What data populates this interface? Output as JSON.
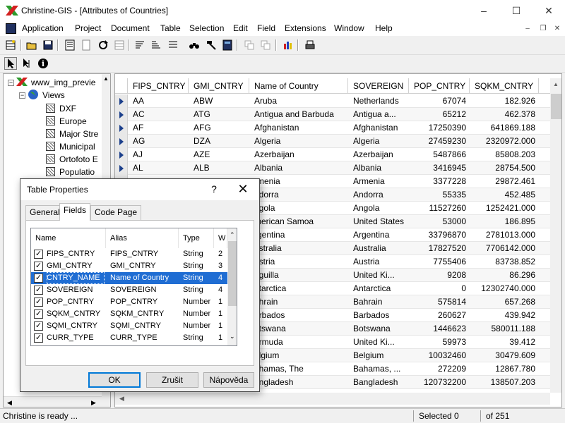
{
  "window": {
    "title": "Christine-GIS - [Attributes of Countries]"
  },
  "menu": [
    "Application",
    "Project",
    "Document",
    "Table",
    "Selection",
    "Edit",
    "Field",
    "Extensions",
    "Window",
    "Help"
  ],
  "tree": {
    "root": "www_img_previe",
    "views": "Views",
    "items": [
      "DXF",
      "Europe",
      "Major Stre",
      "Municipal",
      "Ortofoto E",
      "Populatio"
    ]
  },
  "table": {
    "columns": [
      "FIPS_CNTRY",
      "GMI_CNTRY",
      "Name of Country",
      "SOVEREIGN",
      "POP_CNTRY",
      "SQKM_CNTRY"
    ],
    "rows": [
      [
        "AA",
        "ABW",
        "Aruba",
        "Netherlands",
        "67074",
        "182.926"
      ],
      [
        "AC",
        "ATG",
        "Antigua and Barbuda",
        "Antigua a...",
        "65212",
        "462.378"
      ],
      [
        "AF",
        "AFG",
        "Afghanistan",
        "Afghanistan",
        "17250390",
        "641869.188"
      ],
      [
        "AG",
        "DZA",
        "Algeria",
        "Algeria",
        "27459230",
        "2320972.000"
      ],
      [
        "AJ",
        "AZE",
        "Azerbaijan",
        "Azerbaijan",
        "5487866",
        "85808.203"
      ],
      [
        "AL",
        "ALB",
        "Albania",
        "Albania",
        "3416945",
        "28754.500"
      ],
      [
        "",
        "",
        "rmenia",
        "Armenia",
        "3377228",
        "29872.461"
      ],
      [
        "",
        "",
        "ndorra",
        "Andorra",
        "55335",
        "452.485"
      ],
      [
        "",
        "",
        "ngola",
        "Angola",
        "11527260",
        "1252421.000"
      ],
      [
        "",
        "",
        "merican Samoa",
        "United States",
        "53000",
        "186.895"
      ],
      [
        "",
        "",
        "rgentina",
        "Argentina",
        "33796870",
        "2781013.000"
      ],
      [
        "",
        "",
        "ustralia",
        "Australia",
        "17827520",
        "7706142.000"
      ],
      [
        "",
        "",
        "ustria",
        "Austria",
        "7755406",
        "83738.852"
      ],
      [
        "",
        "",
        "nguilla",
        "United Ki...",
        "9208",
        "86.296"
      ],
      [
        "",
        "",
        "ntarctica",
        "Antarctica",
        "0",
        "12302740.000"
      ],
      [
        "",
        "",
        "ahrain",
        "Bahrain",
        "575814",
        "657.268"
      ],
      [
        "",
        "",
        "arbados",
        "Barbados",
        "260627",
        "439.942"
      ],
      [
        "",
        "",
        "otswana",
        "Botswana",
        "1446623",
        "580011.188"
      ],
      [
        "",
        "",
        "ermuda",
        "United Ki...",
        "59973",
        "39.412"
      ],
      [
        "",
        "",
        "elgium",
        "Belgium",
        "10032460",
        "30479.609"
      ],
      [
        "",
        "",
        "ahamas, The",
        "Bahamas, ...",
        "272209",
        "12867.780"
      ],
      [
        "",
        "",
        "angladesh",
        "Bangladesh",
        "120732200",
        "138507.203"
      ]
    ]
  },
  "dialog": {
    "title": "Table Properties",
    "help": "?",
    "tabs": [
      "General",
      "Fields",
      "Code Page"
    ],
    "selected_tab": "Fields",
    "list_headers": [
      "Name",
      "Alias",
      "Type",
      "W"
    ],
    "fields": [
      {
        "name": "FIPS_CNTRY",
        "alias": "FIPS_CNTRY",
        "type": "String",
        "w": "2",
        "checked": true
      },
      {
        "name": "GMI_CNTRY",
        "alias": "GMI_CNTRY",
        "type": "String",
        "w": "3",
        "checked": true
      },
      {
        "name": "CNTRY_NAME",
        "alias": "Name of Country",
        "type": "String",
        "w": "4",
        "checked": true,
        "selected": true
      },
      {
        "name": "SOVEREIGN",
        "alias": "SOVEREIGN",
        "type": "String",
        "w": "4",
        "checked": true
      },
      {
        "name": "POP_CNTRY",
        "alias": "POP_CNTRY",
        "type": "Number",
        "w": "1",
        "checked": true
      },
      {
        "name": "SQKM_CNTRY",
        "alias": "SQKM_CNTRY",
        "type": "Number",
        "w": "1",
        "checked": true
      },
      {
        "name": "SQMI_CNTRY",
        "alias": "SQMI_CNTRY",
        "type": "Number",
        "w": "1",
        "checked": true
      },
      {
        "name": "CURR_TYPE",
        "alias": "CURR_TYPE",
        "type": "String",
        "w": "1",
        "checked": true
      }
    ],
    "buttons": {
      "ok": "OK",
      "cancel": "Zrušit",
      "help": "Nápověda"
    }
  },
  "status": {
    "message": "Christine is ready ...",
    "selected": "Selected 0",
    "total": "of 251"
  },
  "colors": {
    "accent": "#0078d7",
    "selection": "#1f6dd3",
    "row_indicator": "#1b3f8b"
  },
  "icons": {
    "minimize": "minimize-icon",
    "maximize": "maximize-icon",
    "close": "close-icon"
  }
}
